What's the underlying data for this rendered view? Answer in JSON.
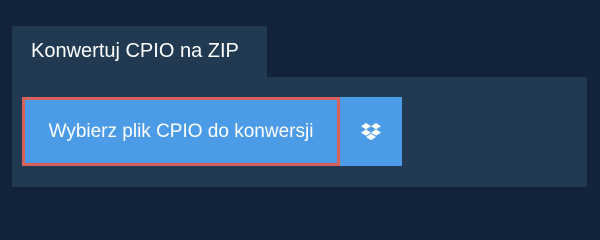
{
  "tab": {
    "label": "Konwertuj CPIO na ZIP"
  },
  "upload": {
    "select_label": "Wybierz plik CPIO do konwersji",
    "dropbox_icon": "dropbox-icon"
  },
  "colors": {
    "page_background": "#13233a",
    "panel_background": "#213a52",
    "button_background": "#4c9be6",
    "button_focus_border": "#d9605a",
    "text": "#ffffff"
  }
}
